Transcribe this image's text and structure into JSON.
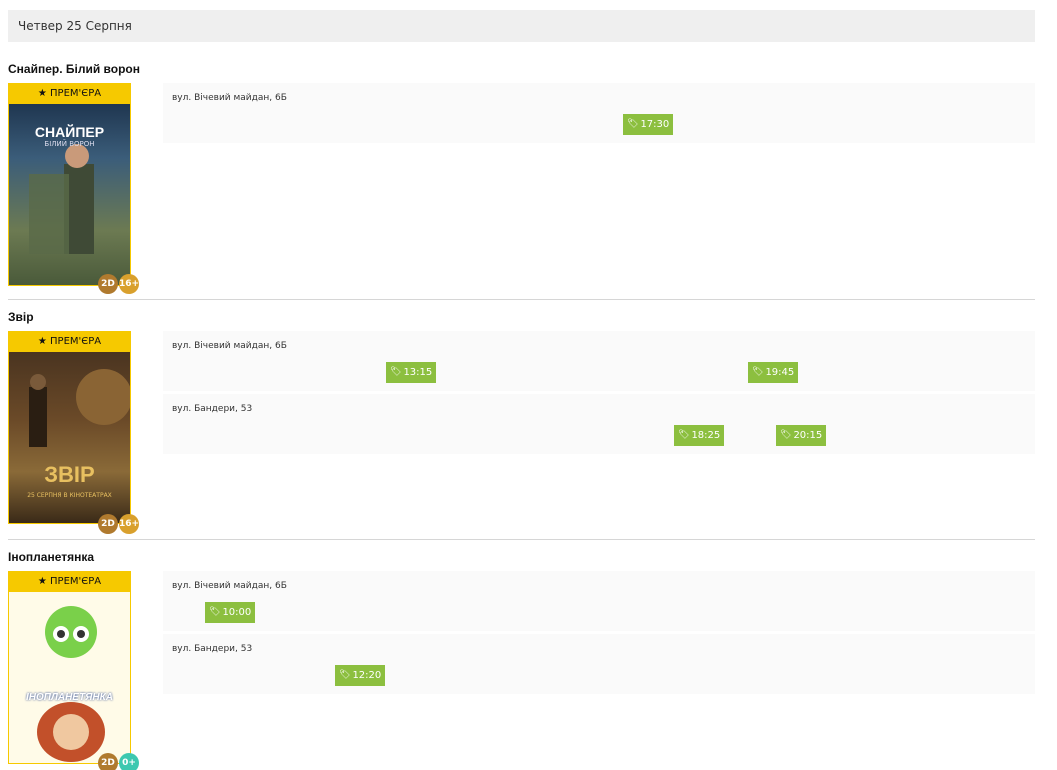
{
  "date_label": "Четвер 25 Серпня",
  "premiere_label": "★ ПРЕМ'ЄРА",
  "movies": [
    {
      "title": "Снайпер. Білий ворон",
      "format": "2D",
      "age": "16+",
      "poster_colors": [
        "#3b5d7a",
        "#7a8a5a"
      ],
      "poster_title": "СНАЙПЕР",
      "poster_sub": "БІЛИЙ ВОРОН",
      "venues": [
        {
          "name": "вул. Вічевий майдан, 6Б",
          "times": [
            "17:30"
          ]
        }
      ]
    },
    {
      "title": "Звір",
      "format": "2D",
      "age": "16+",
      "poster_colors": [
        "#5a3a1e",
        "#a07a3c"
      ],
      "poster_title": "ЗВІР",
      "poster_sub": "25 СЕРПНЯ В КІНОТЕАТРАХ",
      "venues": [
        {
          "name": "вул. Вічевий майдан, 6Б",
          "times": [
            "13:15",
            "19:45"
          ]
        },
        {
          "name": "вул. Бандери, 53",
          "times": [
            "18:25",
            "20:15"
          ]
        }
      ]
    },
    {
      "title": "Інопланетянка",
      "format": "2D",
      "age": "0+",
      "poster_colors": [
        "#fff3c0",
        "#e05a2a"
      ],
      "poster_title": "ІНОПЛАНЕТЯНКА",
      "poster_sub": "",
      "venues": [
        {
          "name": "вул. Вічевий майдан, 6Б",
          "times": [
            "10:00"
          ]
        },
        {
          "name": "вул. Бандери, 53",
          "times": [
            "12:20"
          ]
        }
      ]
    }
  ]
}
